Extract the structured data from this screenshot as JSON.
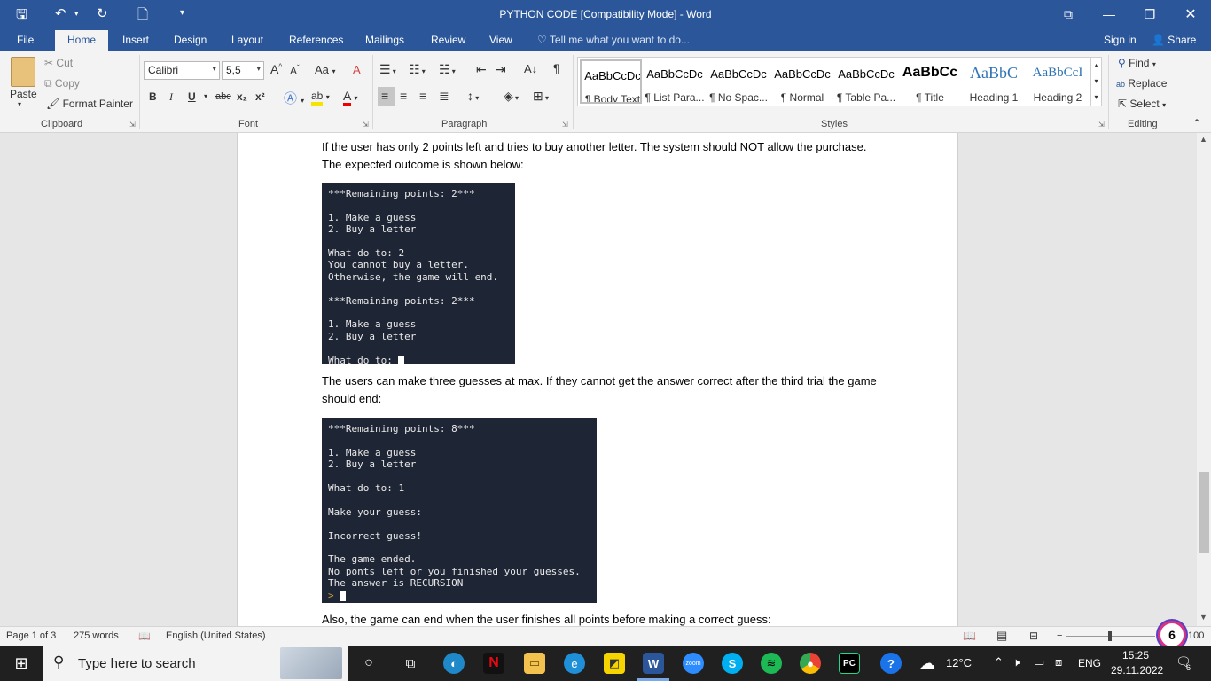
{
  "title": "PYTHON CODE [Compatibility Mode] - Word",
  "tabs": [
    "File",
    "Home",
    "Insert",
    "Design",
    "Layout",
    "References",
    "Mailings",
    "Review",
    "View"
  ],
  "tell_me": "Tell me what you want to do...",
  "account": {
    "sign_in": "Sign in",
    "share": "Share"
  },
  "clipboard": {
    "paste": "Paste",
    "cut": "Cut",
    "copy": "Copy",
    "format_painter": "Format Painter",
    "label": "Clipboard"
  },
  "font": {
    "name": "Calibri",
    "size": "5,5",
    "label": "Font",
    "bold": "B",
    "italic": "I",
    "underline": "U",
    "strike": "abc",
    "sub": "x₂",
    "sup": "x²",
    "case": "Aa",
    "grow": "A",
    "shrink": "A",
    "color_a": "A",
    "clear": "A"
  },
  "paragraph": {
    "label": "Paragraph"
  },
  "styles": {
    "label": "Styles",
    "items": [
      {
        "preview": "AaBbCcDc",
        "name": "¶ Body Text"
      },
      {
        "preview": "AaBbCcDc",
        "name": "¶ List Para..."
      },
      {
        "preview": "AaBbCcDc",
        "name": "¶ No Spac..."
      },
      {
        "preview": "AaBbCcDc",
        "name": "¶ Normal"
      },
      {
        "preview": "AaBbCcDc",
        "name": "¶ Table Pa..."
      },
      {
        "preview": "AaBbCc",
        "name": "¶ Title"
      },
      {
        "preview": "AaBbC",
        "name": "Heading 1"
      },
      {
        "preview": "AaBbCcI",
        "name": "Heading 2"
      }
    ]
  },
  "editing": {
    "find": "Find",
    "replace": "Replace",
    "select": "Select",
    "label": "Editing"
  },
  "doc": {
    "p1": "If the user has only 2 points left and tries to buy another letter. The system should NOT allow the purchase. The expected outcome is shown below:",
    "term1": [
      "***Remaining points: 2***",
      "",
      "1. Make a guess",
      "2. Buy a letter",
      "",
      "What do to: 2",
      "You cannot buy a letter.",
      "Otherwise, the game will end.",
      "",
      "***Remaining points: 2***",
      "",
      "1. Make a guess",
      "2. Buy a letter",
      "",
      "What do to: "
    ],
    "p2": "The users can make three guesses at max. If they cannot get the answer correct after the third trial the game should end:",
    "term2": [
      "***Remaining points: 8***",
      "",
      "1. Make a guess",
      "2. Buy a letter",
      "",
      "What do to: 1",
      "",
      "Make your guess:",
      "",
      "Incorrect guess!",
      "",
      "The game ended.",
      "No ponts left or you finished your guesses.",
      "The answer is RECURSION"
    ],
    "term2_prompt": ">",
    "p3": "Also, the game can end when the user finishes all points before making a correct guess:"
  },
  "status": {
    "page": "Page 1 of 3",
    "words": "275 words",
    "language": "English (United States)",
    "zoom": "100",
    "badge": "6"
  },
  "taskbar": {
    "search": "Type here to search",
    "weather": "12°C",
    "lang": "ENG",
    "time": "15:25",
    "date": "29.11.2022",
    "notif": "6"
  }
}
